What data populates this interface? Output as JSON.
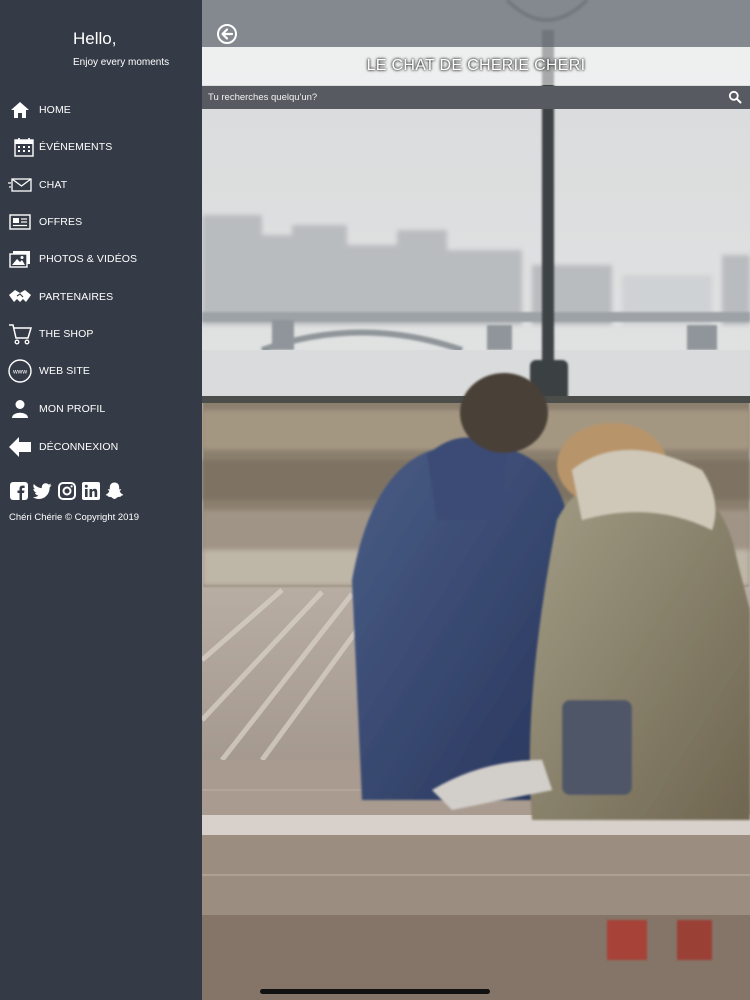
{
  "sidebar": {
    "greeting": "Hello,",
    "tagline": "Enjoy every moments",
    "items": [
      {
        "label": "HOME",
        "icon": "home-icon"
      },
      {
        "label": "ÉVÉNEMENTS",
        "icon": "calendar-icon"
      },
      {
        "label": "CHAT",
        "icon": "envelope-icon"
      },
      {
        "label": "OFFRES",
        "icon": "newspaper-icon"
      },
      {
        "label": "PHOTOS & VIDÉOS",
        "icon": "images-icon"
      },
      {
        "label": "PARTENAIRES",
        "icon": "handshake-icon"
      },
      {
        "label": "THE SHOP",
        "icon": "cart-icon"
      },
      {
        "label": "WEB SITE",
        "icon": "www-icon"
      },
      {
        "label": "MON PROFIL",
        "icon": "user-icon"
      },
      {
        "label": "DÉCONNEXION",
        "icon": "arrow-left-icon"
      }
    ],
    "socials": [
      "facebook-icon",
      "twitter-icon",
      "instagram-icon",
      "linkedin-icon",
      "snapchat-icon"
    ],
    "copyright": "Chéri Chérie © Copyright 2019"
  },
  "header": {
    "title": "LE CHAT DE CHERIE CHERI"
  },
  "search": {
    "placeholder": "Tu recherches quelqu'un?"
  },
  "colors": {
    "sidebar_bg": "#353b46",
    "search_bg": "#575a60"
  }
}
